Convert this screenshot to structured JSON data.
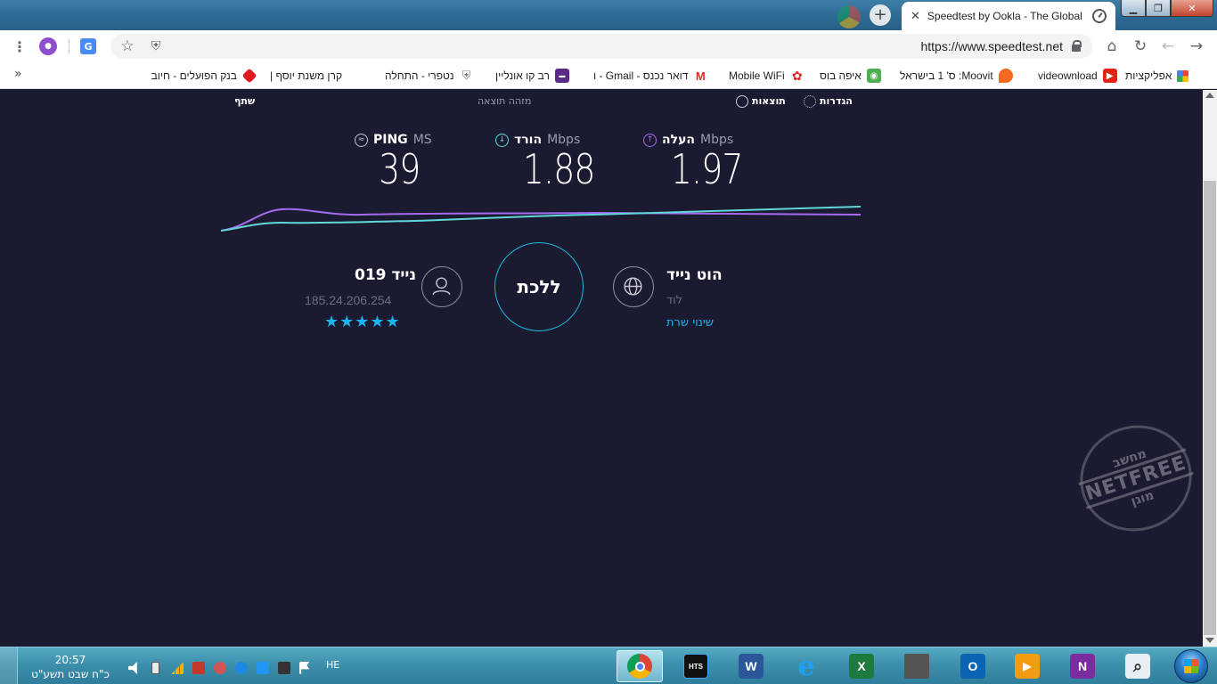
{
  "window": {
    "tab_title": "Speedtest by Ookla - The Global",
    "tab_close": "✕",
    "new_tab": "+",
    "min_glyph": "▁",
    "max_glyph": "❐",
    "close_glyph": "✕"
  },
  "toolbar": {
    "url": "https://www.speedtest.net",
    "menu_glyph": "⋮",
    "profile_glyph": "●",
    "translate_glyph": "G",
    "star_glyph": "☆",
    "ext_glyph": "⛨",
    "home_glyph": "⌂",
    "reload_glyph": "↻",
    "back_glyph": "←",
    "forward_glyph": "→"
  },
  "bookmarks": {
    "more": "»",
    "items": [
      {
        "label": "אפליקציות",
        "icon": "apps-grid-icon"
      },
      {
        "label": "videownload",
        "icon": "youtube-icon"
      },
      {
        "label": "Moovit: ס' 1 בישראל",
        "icon": "moovit-icon"
      },
      {
        "label": "איפה בוס",
        "icon": "owl-icon"
      },
      {
        "label": "Mobile WiFi",
        "icon": "huawei-icon"
      },
      {
        "label": "דואר נכנס - Gmail - ו",
        "icon": "gmail-icon"
      },
      {
        "label": "רב קו אונליין",
        "icon": "ravkav-icon"
      },
      {
        "label": "נטפרי - התחלה",
        "icon": "netfree-icon"
      },
      {
        "label": "קרן משנת יוסף |",
        "icon": ""
      },
      {
        "label": "בנק הפועלים - חיוב",
        "icon": "bank-icon"
      }
    ]
  },
  "speedtest": {
    "nav": {
      "share": "שתף",
      "result_id": "מזהה תוצאה",
      "results": "תוצאות",
      "settings": "הגדרות"
    },
    "ping": {
      "label": "PING",
      "unit": "MS",
      "value": "39"
    },
    "download": {
      "label": "הורד",
      "unit": "Mbps",
      "value": "1.88"
    },
    "upload": {
      "label": "העלה",
      "unit": "Mbps",
      "value": "1.97"
    },
    "isp": {
      "name": "נייד 019",
      "ip": "185.24.206.254",
      "stars": "★★★★★"
    },
    "go_label": "ללכת",
    "server": {
      "name": "הוט נייד",
      "location": "לוד",
      "change": "שינוי שרת"
    },
    "colors": {
      "download": "#5fd8d6",
      "upload": "#a46af0",
      "accent": "#1cb3f0",
      "background": "#1a1b31"
    }
  },
  "watermark": {
    "top": "מחשב",
    "middle": "NETFREE",
    "bottom": "מוגן"
  },
  "taskbar": {
    "time": "20:57",
    "date": "כ\"ח שבט תשע\"ט",
    "language": "HE",
    "apps": [
      {
        "name": "onenote",
        "glyph": "N",
        "color": "#7a2d9e"
      },
      {
        "name": "outlook",
        "glyph": "O",
        "color": "#0a64b3"
      },
      {
        "name": "excel",
        "glyph": "X",
        "color": "#1d7a3f"
      },
      {
        "name": "word",
        "glyph": "W",
        "color": "#2b579a"
      },
      {
        "name": "hts",
        "glyph": "HTS",
        "color": "#111111"
      }
    ]
  }
}
